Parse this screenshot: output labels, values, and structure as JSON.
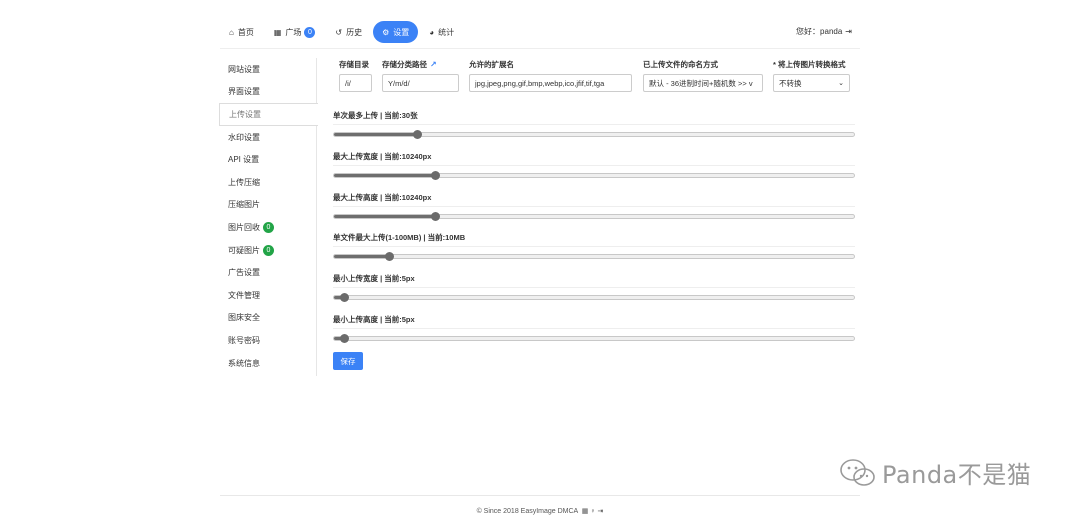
{
  "nav": {
    "items": [
      {
        "icon": "home-icon",
        "glyph": "⌂",
        "label": "首页"
      },
      {
        "icon": "grid-icon",
        "glyph": "▦",
        "label": "广场",
        "badge": "0"
      },
      {
        "icon": "history-icon",
        "glyph": "↺",
        "label": "历史"
      },
      {
        "icon": "cogs-icon",
        "glyph": "⚙",
        "label": "设置",
        "active": true
      },
      {
        "icon": "pie-chart-icon",
        "glyph": "◕",
        "label": "统计"
      }
    ],
    "greeting": "您好：panda",
    "logout_glyph": "⇥"
  },
  "sidebar": {
    "items": [
      {
        "label": "网站设置"
      },
      {
        "label": "界面设置"
      },
      {
        "label": "上传设置",
        "active": true
      },
      {
        "label": "水印设置"
      },
      {
        "label": "API 设置"
      },
      {
        "label": "上传压缩"
      },
      {
        "label": "压缩图片"
      },
      {
        "label": "图片回收",
        "badge": "0"
      },
      {
        "label": "可疑图片",
        "badge": "0"
      },
      {
        "label": "广告设置"
      },
      {
        "label": "文件管理"
      },
      {
        "label": "图床安全"
      },
      {
        "label": "账号密码"
      },
      {
        "label": "系统信息"
      }
    ]
  },
  "upload": {
    "storage_dir": {
      "label": "存储目录",
      "value": "/i/"
    },
    "storage_path": {
      "label": "存储分类路径",
      "value": "Y/m/d/"
    },
    "extensions": {
      "label": "允许的扩展名",
      "value": "jpg,jpeg,png,gif,bmp,webp,ico,jfif,tif,tga"
    },
    "naming": {
      "label": "已上传文件的命名方式",
      "value": "默认 - 36进制时间+随机数 >> v"
    },
    "convert": {
      "label": "* 将上传图片转换格式",
      "value": "不转换"
    },
    "sliders": [
      {
        "label": "单次最多上传 | 当前:30张",
        "fraction": 0.16
      },
      {
        "label": "最大上传宽度 | 当前:10240px",
        "fraction": 0.195
      },
      {
        "label": "最大上传高度 | 当前:10240px",
        "fraction": 0.195
      },
      {
        "label": "单文件最大上传(1-100MB) | 当前:10MB",
        "fraction": 0.105
      },
      {
        "label": "最小上传宽度 | 当前:5px",
        "fraction": 0.02
      },
      {
        "label": "最小上传高度 | 当前:5px",
        "fraction": 0.02
      }
    ],
    "save_label": "保存"
  },
  "footer": {
    "text": "© Since 2018 EasyImage DMCA",
    "glyphs": "▦ ♀ ⇥"
  },
  "watermark": {
    "text": "Panda不是猫"
  },
  "colors": {
    "accent": "#3b82f6",
    "badge_green": "#22a447"
  }
}
